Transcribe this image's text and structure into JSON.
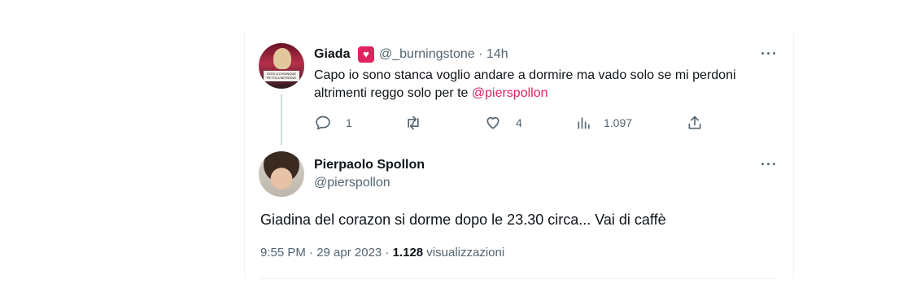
{
  "original_tweet": {
    "author_name": "Giada",
    "author_handle": "@_burningstone",
    "separator": "·",
    "time_ago": "14h",
    "more_icon": "more-icon",
    "text_line1": "Capo io sono stanca voglio andare a dormire ma vado solo se mi perdoni",
    "text_line2_prefix": "altrimenti reggo solo per te ",
    "mention": "@pierspollon",
    "avatar_caption": "OGGI A CHIUNQUE PETTA A NESSUNO",
    "actions": {
      "reply_count": "1",
      "retweet_count": "",
      "like_count": "4",
      "views_count": "1.097"
    }
  },
  "reply_tweet": {
    "author_name": "Pierpaolo Spollon",
    "author_handle": "@pierspollon",
    "text": "Giadina del corazon si dorme dopo le 23.30 circa... Vai di caffè",
    "timestamp": "9:55 PM · 29 apr 2023 · ",
    "views_count": "1.128",
    "views_label": " visualizzazioni"
  },
  "colors": {
    "mention": "#e0245e",
    "badge": "#e0245e",
    "secondary_text": "#536471"
  }
}
